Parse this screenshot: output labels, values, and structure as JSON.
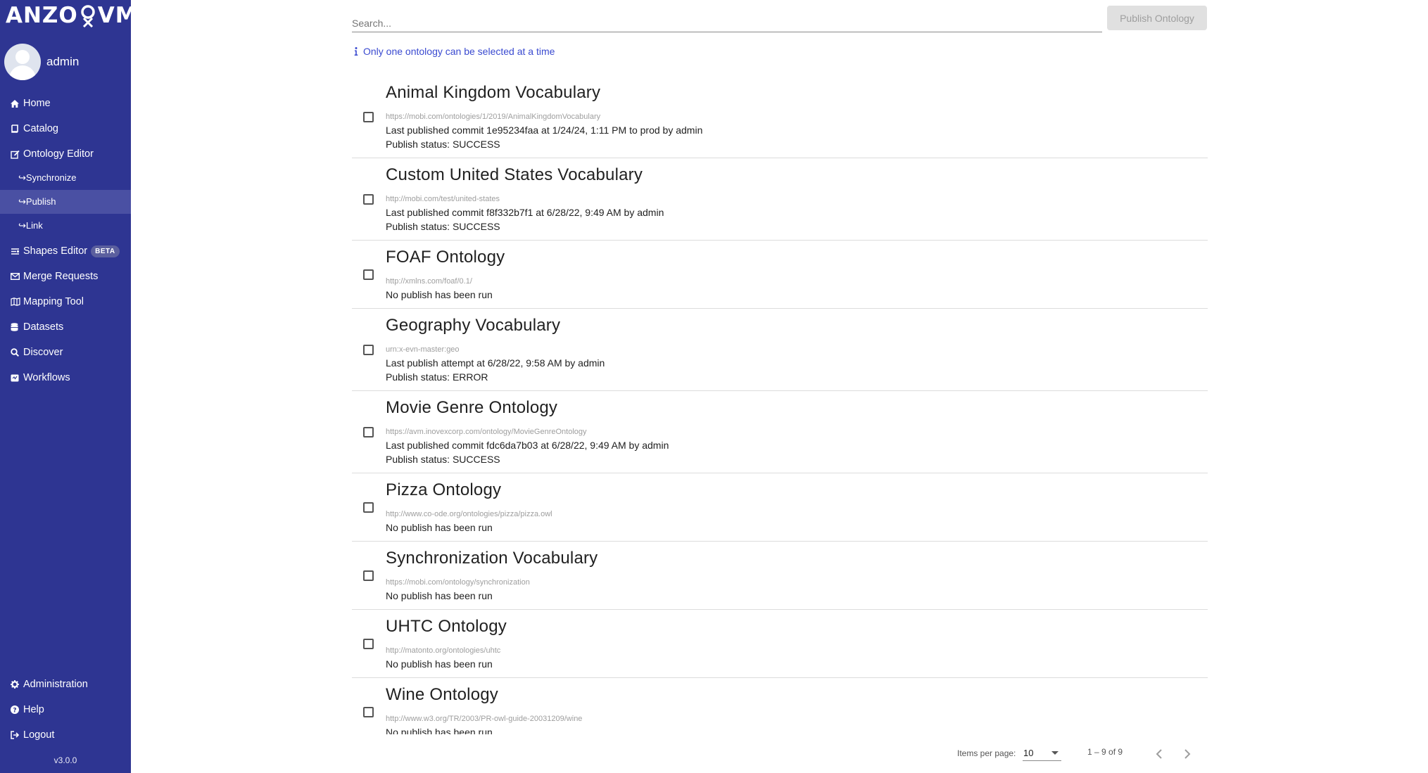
{
  "brand": {
    "logo_text": "ANZO",
    "logo_text_b": "VM"
  },
  "user": {
    "name": "admin"
  },
  "nav": {
    "home": "Home",
    "catalog": "Catalog",
    "ontology_editor": "Ontology Editor",
    "synchronize": "↪Synchronize",
    "publish": "↪Publish",
    "link": "↪Link",
    "shapes_editor": "Shapes Editor",
    "shapes_badge": "BETA",
    "merge_requests": "Merge Requests",
    "mapping_tool": "Mapping Tool",
    "datasets": "Datasets",
    "discover": "Discover",
    "workflows": "Workflows",
    "administration": "Administration",
    "help": "Help",
    "logout": "Logout",
    "version": "v3.0.0"
  },
  "search": {
    "placeholder": "Search...",
    "value": ""
  },
  "toolbar": {
    "publish_label": "Publish Ontology"
  },
  "info": {
    "text": "Only one ontology can be selected at a time"
  },
  "ontologies": [
    {
      "title": "Animal Kingdom Vocabulary",
      "iri": "https://mobi.com/ontologies/1/2019/AnimalKingdomVocabulary",
      "line1": "Last published commit 1e95234faa at 1/24/24, 1:11 PM to prod by admin",
      "line2": "Publish status: SUCCESS"
    },
    {
      "title": "Custom United States Vocabulary",
      "iri": "http://mobi.com/test/united-states",
      "line1": "Last published commit f8f332b7f1 at 6/28/22, 9:49 AM by admin",
      "line2": "Publish status: SUCCESS"
    },
    {
      "title": "FOAF Ontology",
      "iri": "http://xmlns.com/foaf/0.1/",
      "line1": "No publish has been run"
    },
    {
      "title": "Geography Vocabulary",
      "iri": "urn:x-evn-master:geo",
      "line1": "Last publish attempt at 6/28/22, 9:58 AM by admin",
      "line2": "Publish status: ERROR"
    },
    {
      "title": "Movie Genre Ontology",
      "iri": "https://avm.inovexcorp.com/ontology/MovieGenreOntology",
      "line1": "Last published commit fdc6da7b03 at 6/28/22, 9:49 AM by admin",
      "line2": "Publish status: SUCCESS"
    },
    {
      "title": "Pizza Ontology",
      "iri": "http://www.co-ode.org/ontologies/pizza/pizza.owl",
      "line1": "No publish has been run"
    },
    {
      "title": "Synchronization Vocabulary",
      "iri": "https://mobi.com/ontology/synchronization",
      "line1": "No publish has been run"
    },
    {
      "title": "UHTC Ontology",
      "iri": "http://matonto.org/ontologies/uhtc",
      "line1": "No publish has been run"
    },
    {
      "title": "Wine Ontology",
      "iri": "http://www.w3.org/TR/2003/PR-owl-guide-20031209/wine",
      "line1": "No publish has been run"
    }
  ],
  "paginator": {
    "items_per_page_label": "Items per page:",
    "items_per_page": "10",
    "range": "1 – 9 of 9"
  }
}
